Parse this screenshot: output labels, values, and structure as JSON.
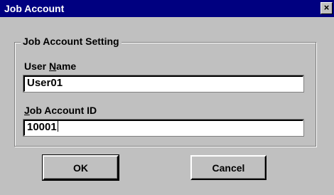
{
  "window": {
    "title": "Job Account",
    "close_glyph": "×"
  },
  "group": {
    "legend": "Job Account Setting"
  },
  "user_name": {
    "label_prefix": "User ",
    "label_accel": "N",
    "label_suffix": "ame",
    "value": "User01"
  },
  "job_account_id": {
    "label_prefix": "",
    "label_accel": "J",
    "label_suffix": "ob Account ID",
    "value": "10001"
  },
  "buttons": {
    "ok": "OK",
    "cancel": "Cancel"
  }
}
